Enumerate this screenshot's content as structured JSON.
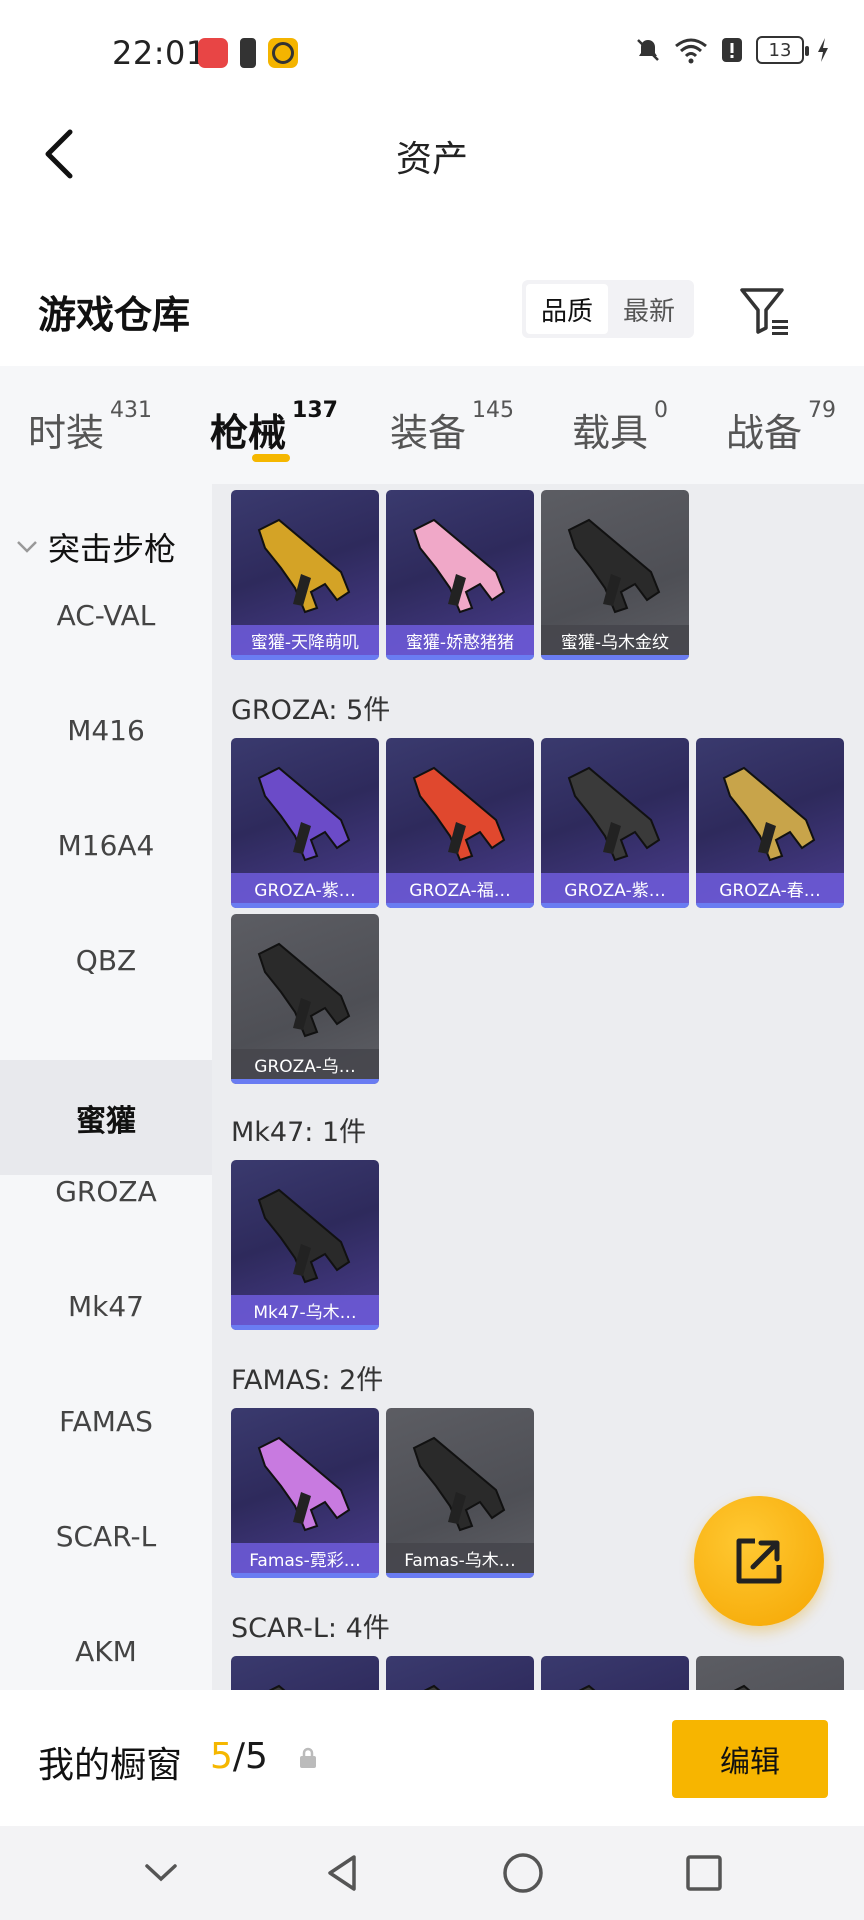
{
  "status": {
    "time": "22:01",
    "battery": "13"
  },
  "header": {
    "title": "资产"
  },
  "warehouse": {
    "title": "游戏仓库",
    "sort_options": [
      "品质",
      "最新"
    ],
    "active_sort": "品质"
  },
  "tabs": [
    {
      "label": "时装",
      "count": "431"
    },
    {
      "label": "枪械",
      "count": "137"
    },
    {
      "label": "装备",
      "count": "145"
    },
    {
      "label": "载具",
      "count": "0"
    },
    {
      "label": "战备",
      "count": "79"
    }
  ],
  "active_tab": "枪械",
  "sidebar": {
    "group": "突击步枪",
    "items": [
      "AC-VAL",
      "M416",
      "M16A4",
      "QBZ",
      "蜜獾",
      "GROZA",
      "Mk47",
      "FAMAS",
      "SCAR-L",
      "AKM"
    ],
    "active": "蜜獾"
  },
  "sections": [
    {
      "label": "",
      "items": [
        {
          "name": "蜜獾-天降萌叽",
          "style": "purple",
          "color": "#d4a326"
        },
        {
          "name": "蜜獾-娇憨猪猪",
          "style": "purple",
          "color": "#f0a8c8"
        },
        {
          "name": "蜜獾-乌木金纹",
          "style": "gray",
          "color": "#2a2a2a"
        }
      ]
    },
    {
      "label": "GROZA: 5件",
      "items": [
        {
          "name": "GROZA-紫…",
          "style": "purple",
          "color": "#6b4bc8"
        },
        {
          "name": "GROZA-福…",
          "style": "purple",
          "color": "#e0482e"
        },
        {
          "name": "GROZA-紫…",
          "style": "purple",
          "color": "#3a3a3a"
        },
        {
          "name": "GROZA-春…",
          "style": "purple",
          "color": "#c8a44a"
        },
        {
          "name": "GROZA-乌…",
          "style": "gray",
          "color": "#2a2a2a"
        }
      ]
    },
    {
      "label": "Mk47: 1件",
      "items": [
        {
          "name": "Mk47-乌木…",
          "style": "purple",
          "color": "#2a2a2a"
        }
      ]
    },
    {
      "label": "FAMAS: 2件",
      "items": [
        {
          "name": "Famas-霓彩…",
          "style": "purple",
          "color": "#c87ae0"
        },
        {
          "name": "Famas-乌木…",
          "style": "gray",
          "color": "#2a2a2a"
        }
      ]
    },
    {
      "label": "SCAR-L: 4件",
      "items": [
        {
          "name": "",
          "style": "purple",
          "color": "#3a3a3a"
        },
        {
          "name": "",
          "style": "purple",
          "color": "#3a3a3a"
        },
        {
          "name": "",
          "style": "purple",
          "color": "#3a3a3a"
        },
        {
          "name": "",
          "style": "gray",
          "color": "#3a3a3a"
        }
      ]
    }
  ],
  "showcase": {
    "label": "我的橱窗",
    "current": "5",
    "total": "/5",
    "edit_label": "编辑"
  },
  "colors": {
    "accent": "#f5b700",
    "card_purple": "#2e2a5c",
    "card_name_bar": "#6e5cdc"
  }
}
